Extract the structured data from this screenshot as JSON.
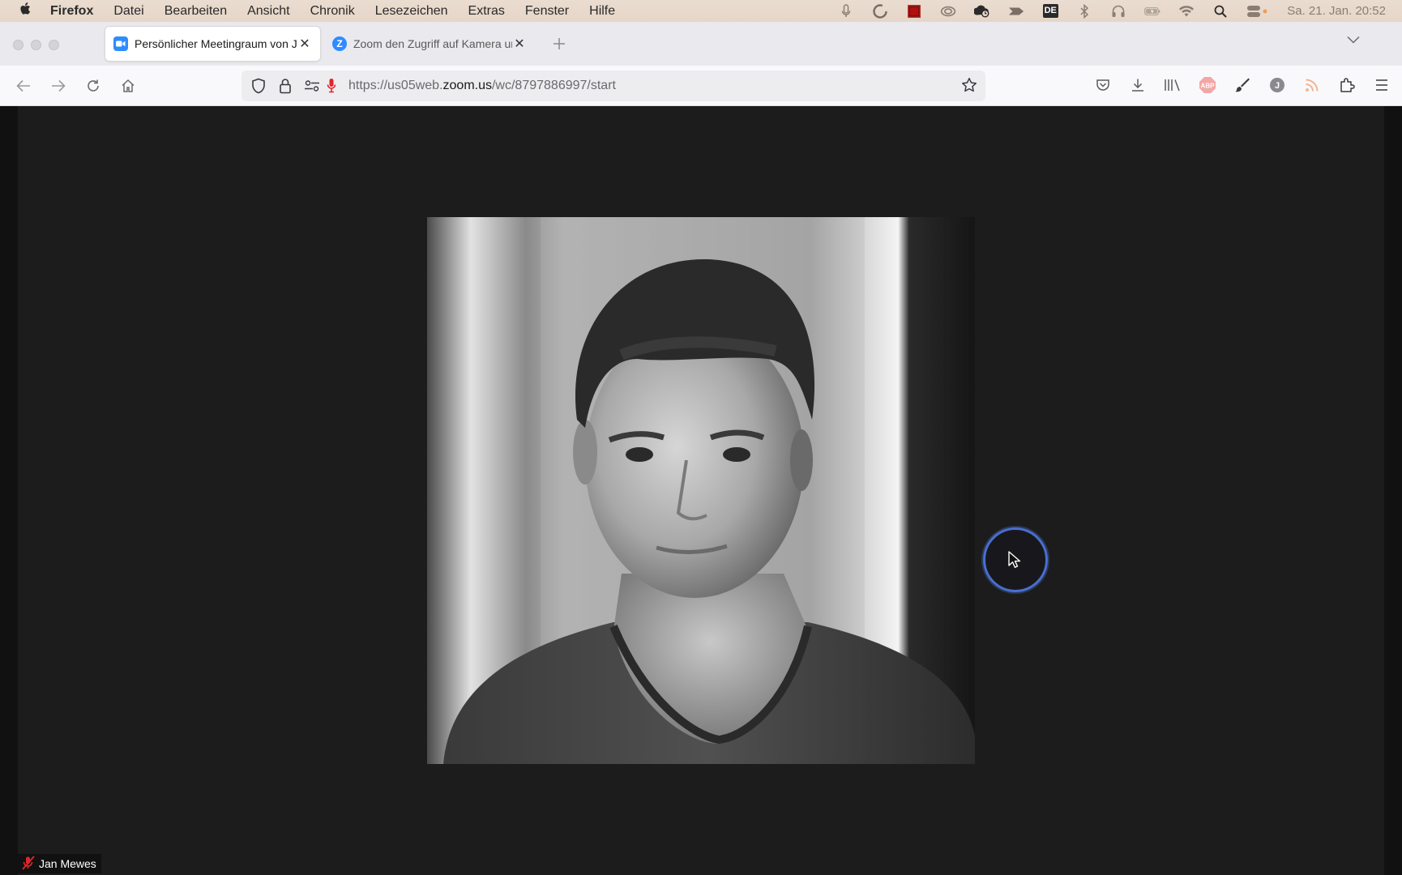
{
  "menubar": {
    "app_name": "Firefox",
    "items": [
      "Datei",
      "Bearbeiten",
      "Ansicht",
      "Chronik",
      "Lesezeichen",
      "Extras",
      "Fenster",
      "Hilfe"
    ],
    "input_language": "DE",
    "clock": "Sa. 21. Jan.  20:52"
  },
  "tabs": [
    {
      "label": "Persönlicher Meetingraum von Ja",
      "active": true,
      "icon": "zoom-video-icon"
    },
    {
      "label": "Zoom den Zugriff auf Kamera ur",
      "active": false,
      "icon": "zoom-z-icon"
    }
  ],
  "navbar": {
    "url_prefix": "https://us05web.",
    "url_domain": "zoom.us",
    "url_path": "/wc/8797886997/start",
    "avatar_letter": "J",
    "adblock_label": "ABP"
  },
  "meeting": {
    "participant_name": "Jan Mewes",
    "muted": true
  },
  "colors": {
    "zoom_blue": "#2d8cff",
    "mic_red": "#e0262b",
    "cursor_ring": "#4a6fd0"
  }
}
